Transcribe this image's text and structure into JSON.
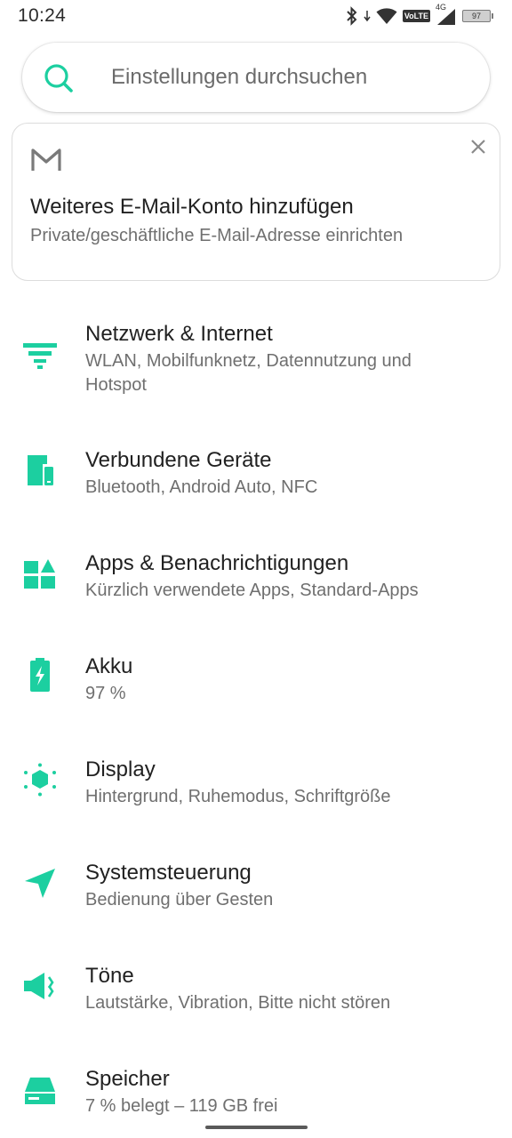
{
  "status_bar": {
    "time": "10:24",
    "volte": "VoLTE",
    "network": "4G",
    "battery": "97",
    "icons": [
      "bluetooth-icon",
      "wifi-icon",
      "volte-icon",
      "signal-icon",
      "battery-icon"
    ]
  },
  "search": {
    "placeholder": "Einstellungen durchsuchen"
  },
  "suggestion_card": {
    "title": "Weiteres E-Mail-Konto hinzufügen",
    "subtitle": "Private/geschäftliche E-Mail-Adresse einrichten",
    "icon": "gmail-icon"
  },
  "settings": [
    {
      "title": "Netzwerk & Internet",
      "subtitle": "WLAN, Mobilfunknetz, Datennutzung und Hotspot",
      "icon": "network-icon"
    },
    {
      "title": "Verbundene Geräte",
      "subtitle": "Bluetooth, Android Auto, NFC",
      "icon": "devices-icon"
    },
    {
      "title": "Apps & Benachrichtigungen",
      "subtitle": "Kürzlich verwendete Apps, Standard-Apps",
      "icon": "apps-icon"
    },
    {
      "title": "Akku",
      "subtitle": "97 %",
      "icon": "battery-icon"
    },
    {
      "title": "Display",
      "subtitle": "Hintergrund, Ruhemodus, Schriftgröße",
      "icon": "display-icon"
    },
    {
      "title": "Systemsteuerung",
      "subtitle": "Bedienung über Gesten",
      "icon": "navigation-icon"
    },
    {
      "title": "Töne",
      "subtitle": "Lautstärke, Vibration, Bitte nicht stören",
      "icon": "sound-icon"
    },
    {
      "title": "Speicher",
      "subtitle": "7 % belegt – 119 GB frei",
      "icon": "storage-icon"
    }
  ],
  "colors": {
    "accent": "#1ccfa0",
    "text_primary": "#212121",
    "text_secondary": "#6f6f6f"
  }
}
